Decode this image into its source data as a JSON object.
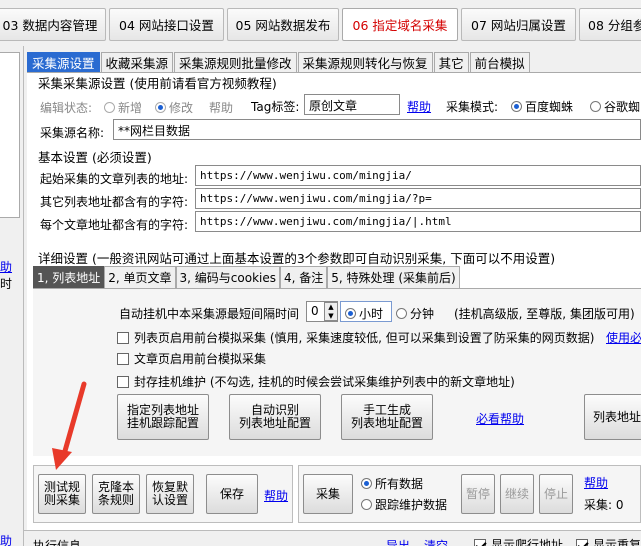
{
  "top_tabs": [
    {
      "label": "03 数据内容管理"
    },
    {
      "label": "04 网站接口设置"
    },
    {
      "label": "05 网站数据发布"
    },
    {
      "label": "06 指定域名采集"
    },
    {
      "label": "07 网站归属设置"
    },
    {
      "label": "08 分组参"
    }
  ],
  "sidebar": {
    "link1": "助",
    "char": "时",
    "link2": "助"
  },
  "sub_tabs": [
    {
      "label": "采集源设置"
    },
    {
      "label": "收藏采集源"
    },
    {
      "label": "采集源规则批量修改"
    },
    {
      "label": "采集源规则转化与恢复"
    },
    {
      "label": "其它"
    },
    {
      "label": "前台模拟"
    }
  ],
  "source": {
    "section_title": "采集采集源设置 (使用前请看官方视频教程)",
    "edit_state_label": "编辑状态:",
    "opt_new": "新增",
    "opt_modify": "修改",
    "help_gray": "帮助",
    "tag_label": "Tag标签:",
    "tag_value": "原创文章",
    "help_link": "帮助",
    "mode_label": "采集模式:",
    "mode_baidu": "百度蜘蛛",
    "mode_google": "谷歌蜘",
    "name_label": "采集源名称:",
    "name_value": "**网栏目数据"
  },
  "basic": {
    "title": "基本设置 (必须设置)",
    "start_label": "起始采集的文章列表的地址:",
    "start_value": "https://www.wenjiwu.com/mingjia/",
    "other_label": "其它列表地址都含有的字符:",
    "other_value": "https://www.wenjiwu.com/mingjia/?p=",
    "article_label": "每个文章地址都含有的字符:",
    "article_value": "https://www.wenjiwu.com/mingjia/|.html"
  },
  "detail": {
    "title": "详细设置 (一般资讯网站可通过上面基本设置的3个参数即可自动识别采集, 下面可以不用设置)",
    "tabs": [
      {
        "label": "1, 列表地址"
      },
      {
        "label": "2, 单页文章"
      },
      {
        "label": "3, 编码与cookies"
      },
      {
        "label": "4, 备注"
      },
      {
        "label": "5, 特殊处理 (采集前后)"
      }
    ],
    "interval_label": "自动挂机中本采集源最短间隔时间",
    "interval_value": "0",
    "unit_hour": "小时",
    "unit_min": "分钟",
    "edition_note": "(挂机高级版, 至尊版, 集团版可用)",
    "check1": "列表页启用前台模拟采集 (慎用, 采集速度较低, 但可以采集到设置了防采集的网页数据)",
    "check1_link": "使用必",
    "check2": "文章页启用前台模拟采集",
    "check3": "封存挂机维护 (不勾选, 挂机的时候会尝试采集维护列表中的新文章地址)",
    "btn_assign": "指定列表地址\n挂机跟踪配置",
    "btn_auto": "自动识别\n列表地址配置",
    "btn_manual": "手工生成\n列表地址配置",
    "must_help": "必看帮助",
    "btn_list": "列表地址"
  },
  "bottom": {
    "btn_test": "测试规\n则采集",
    "btn_clone": "克隆本\n条规则",
    "btn_restore": "恢复默\n认设置",
    "btn_save": "保存",
    "help1": "帮助",
    "btn_collect": "采集",
    "opt_all": "所有数据",
    "opt_track": "跟踪维护数据",
    "btn_pause": "暂停",
    "btn_continue": "继续",
    "btn_stop": "停止",
    "help2": "帮助",
    "collect_count_label": "采集: 0"
  },
  "status_bar": {
    "exec_info": "执行信息",
    "export": "导出",
    "clear": "清空",
    "show_crawl": "显示爬行地址",
    "show_repeat": "显示重复"
  },
  "colors": {
    "active_tab_text": "#d40000",
    "link": "#0000ee",
    "selected_tab": "#2a6bd1",
    "arrow": "#e83a2a"
  }
}
